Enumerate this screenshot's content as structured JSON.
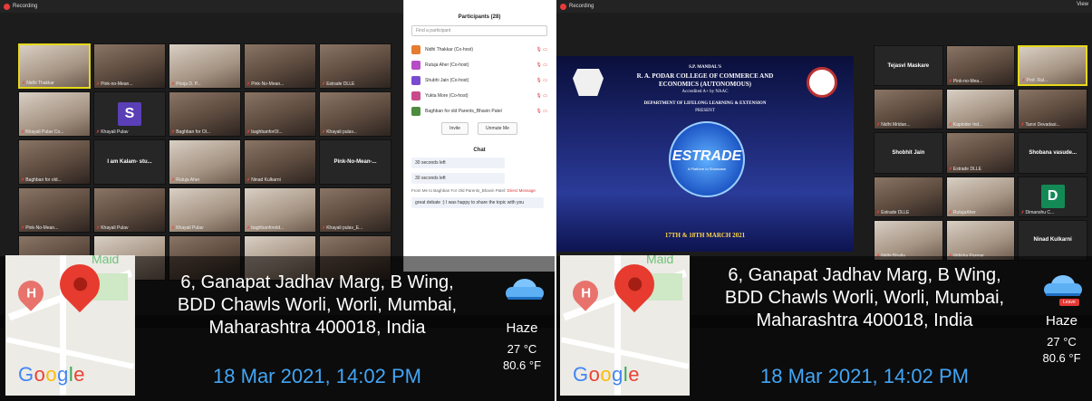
{
  "left": {
    "recording_label": "Recording",
    "participants_panel": {
      "title": "Participants (28)",
      "search_placeholder": "Find a participant",
      "rows": [
        {
          "name": "Nidhi Thakkar (Co-host)",
          "color": "#e57c2f"
        },
        {
          "name": "Rutuja Aher (Co-host)",
          "color": "#b64cc6"
        },
        {
          "name": "Shubhi Jain (Co-host)",
          "color": "#7a4bd2"
        },
        {
          "name": "Yukta More (Co-host)",
          "color": "#c94a8c"
        },
        {
          "name": "Baghban for old Parents_Bhavin Patel",
          "color": "#4d8b3e"
        }
      ],
      "invite_label": "Invite",
      "unmute_all_label": "Unmute Me",
      "chat_title": "Chat",
      "chat_messages": [
        "30 seconds left",
        "30 seconds left"
      ],
      "chat_from": "From Me to Baghban For Old Parents_Bhavin Patel:",
      "chat_from_tag": "Direct Message",
      "chat_last": "great debate :) I was happy to share the topic with you"
    },
    "tiles": [
      {
        "label": "Nidhi Thakkar",
        "kind": "photo light",
        "active": true
      },
      {
        "label": "Pink-no-Mean...",
        "kind": "photo"
      },
      {
        "label": "Pooja D. P...",
        "kind": "photo light"
      },
      {
        "label": "Pink-No-Mean...",
        "kind": "photo"
      },
      {
        "label": "Estrade DLLE",
        "kind": "photo"
      },
      {
        "label": "Khayali Pulav Co...",
        "kind": "photo light"
      },
      {
        "label": "Khayali Pulav",
        "kind": "avatar-s",
        "letter": "S"
      },
      {
        "label": "Baghban for Ol...",
        "kind": "photo"
      },
      {
        "label": "baghbanforOl...",
        "kind": "photo"
      },
      {
        "label": "Khayali pulav...",
        "kind": "photo"
      },
      {
        "label": "Baghban for old...",
        "kind": "photo"
      },
      {
        "label": "",
        "kind": "dark",
        "center": "I am Kalam- stu..."
      },
      {
        "label": "Rutuja Aher",
        "kind": "photo light"
      },
      {
        "label": "Ninad Kulkarni",
        "kind": "photo"
      },
      {
        "label": "",
        "kind": "dark",
        "center": "Pink-No-Mean-..."
      },
      {
        "label": "Pink-No-Mean...",
        "kind": "photo"
      },
      {
        "label": "Khayali Pulav",
        "kind": "photo"
      },
      {
        "label": "Khayali Pulav",
        "kind": "photo light"
      },
      {
        "label": "baghbanforold...",
        "kind": "photo light"
      },
      {
        "label": "Khayali pulav_E...",
        "kind": "photo"
      },
      {
        "label": "",
        "kind": "photo"
      },
      {
        "label": "",
        "kind": "photo light"
      },
      {
        "label": "",
        "kind": "photo"
      },
      {
        "label": "",
        "kind": "photo light"
      },
      {
        "label": "",
        "kind": "photo"
      }
    ],
    "overlay": {
      "map_text": "Maid",
      "address_lines": [
        "6, Ganapat Jadhav Marg, B Wing,",
        "BDD Chawls Worli, Worli, Mumbai,",
        "Maharashtra 400018, India"
      ],
      "datetime": "18 Mar 2021, 14:02 PM",
      "weather_cond": "Haze",
      "temp_c": "27 °C",
      "temp_f": "80.6 °F",
      "google": "Google"
    }
  },
  "right": {
    "recording_label": "Recording",
    "view_label": "View",
    "slide": {
      "line1": "S.P. MANDAL'S",
      "line2": "R. A. PODAR COLLEGE OF COMMERCE AND",
      "line3": "ECONOMICS (AUTONOMOUS)",
      "line4": "Accredited A+ by NAAC",
      "line5": "DEPARTMENT OF LIFELONG LEARNING & EXTENSION",
      "line6": "PRESENT",
      "estrade": "ESTRADE",
      "estrade_sub": "A Platform to Showcase",
      "dates": "17TH & 18TH MARCH 2021"
    },
    "tiles": [
      {
        "label": "",
        "kind": "dark",
        "center": "Tejasvi Maskare"
      },
      {
        "label": "Pink-no-Mea...",
        "kind": "photo"
      },
      {
        "label": "Prof. Ral...",
        "kind": "photo light",
        "active": true
      },
      {
        "label": "Nidhi Mridan...",
        "kind": "photo"
      },
      {
        "label": "Kapinder Ind...",
        "kind": "photo light"
      },
      {
        "label": "Tanvi Devadasi...",
        "kind": "photo"
      },
      {
        "label": "",
        "kind": "dark",
        "center": "Shobhit Jain"
      },
      {
        "label": "Estrade DLLE",
        "kind": "photo"
      },
      {
        "label": "",
        "kind": "dark",
        "center": "Shobana vasude..."
      },
      {
        "label": "Estrade DLLE",
        "kind": "photo"
      },
      {
        "label": "RutujaAher",
        "kind": "photo light"
      },
      {
        "label": "Dimanshu C...",
        "kind": "avatar-d",
        "letter": "D"
      },
      {
        "label": "Nidhi Bhalla",
        "kind": "photo light"
      },
      {
        "label": "Vidisha Parmar",
        "kind": "photo light"
      },
      {
        "label": "",
        "kind": "dark",
        "center": "Ninad Kulkarni"
      }
    ],
    "overlay": {
      "map_text": "Maid",
      "address_lines": [
        "6, Ganapat Jadhav Marg, B Wing,",
        "BDD Chawls Worli, Worli, Mumbai,",
        "Maharashtra 400018, India"
      ],
      "datetime": "18 Mar 2021, 14:02 PM",
      "weather_cond": "Haze",
      "temp_c": "27 °C",
      "temp_f": "80.6 °F",
      "google": "Google",
      "leave_label": "Leave"
    }
  }
}
